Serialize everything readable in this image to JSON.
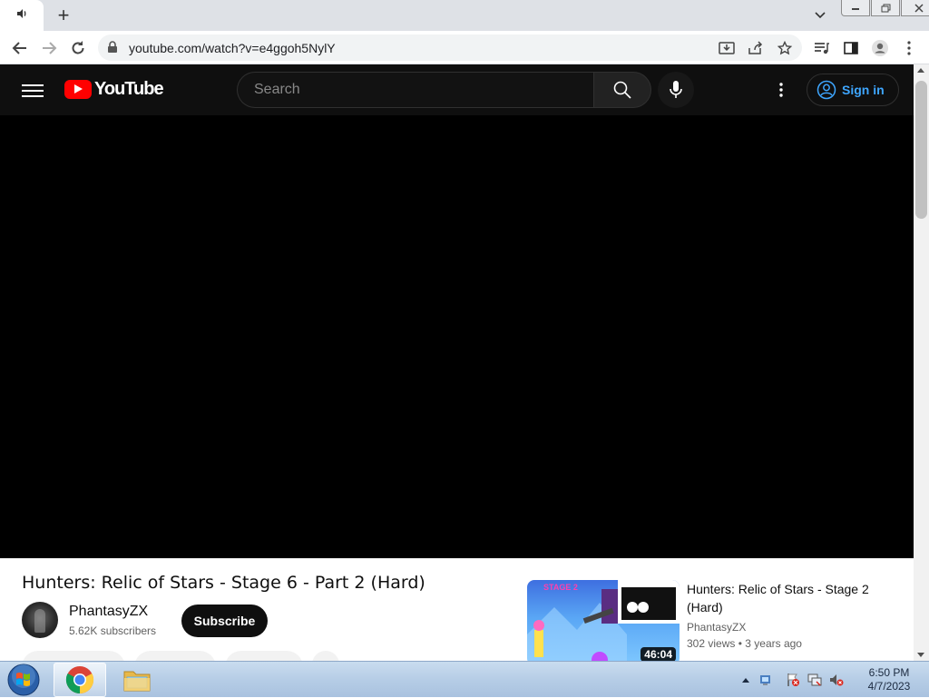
{
  "browser": {
    "address": "youtube.com/watch?v=e4ggoh5NylY",
    "new_tab_label": "+"
  },
  "youtube": {
    "logo_text": "YouTube",
    "search_placeholder": "Search",
    "sign_in_label": "Sign in",
    "video": {
      "title": "Hunters: Relic of Stars - Stage 6 - Part 2 (Hard)",
      "channel_name": "PhantasyZX",
      "subscribers": "5.62K subscribers",
      "subscribe_label": "Subscribe"
    },
    "recommendations": [
      {
        "title": "Hunters: Relic of Stars - Stage 2 (Hard)",
        "channel": "PhantasyZX",
        "views": "302 views",
        "age": "3 years ago",
        "duration": "46:04",
        "thumb_text": "STAGE 2"
      }
    ]
  },
  "taskbar": {
    "time": "6:50 PM",
    "date": "4/7/2023"
  },
  "colors": {
    "yt_header": "#0f0f0f",
    "yt_red": "#ff0000",
    "signin_blue": "#3ea6ff"
  }
}
